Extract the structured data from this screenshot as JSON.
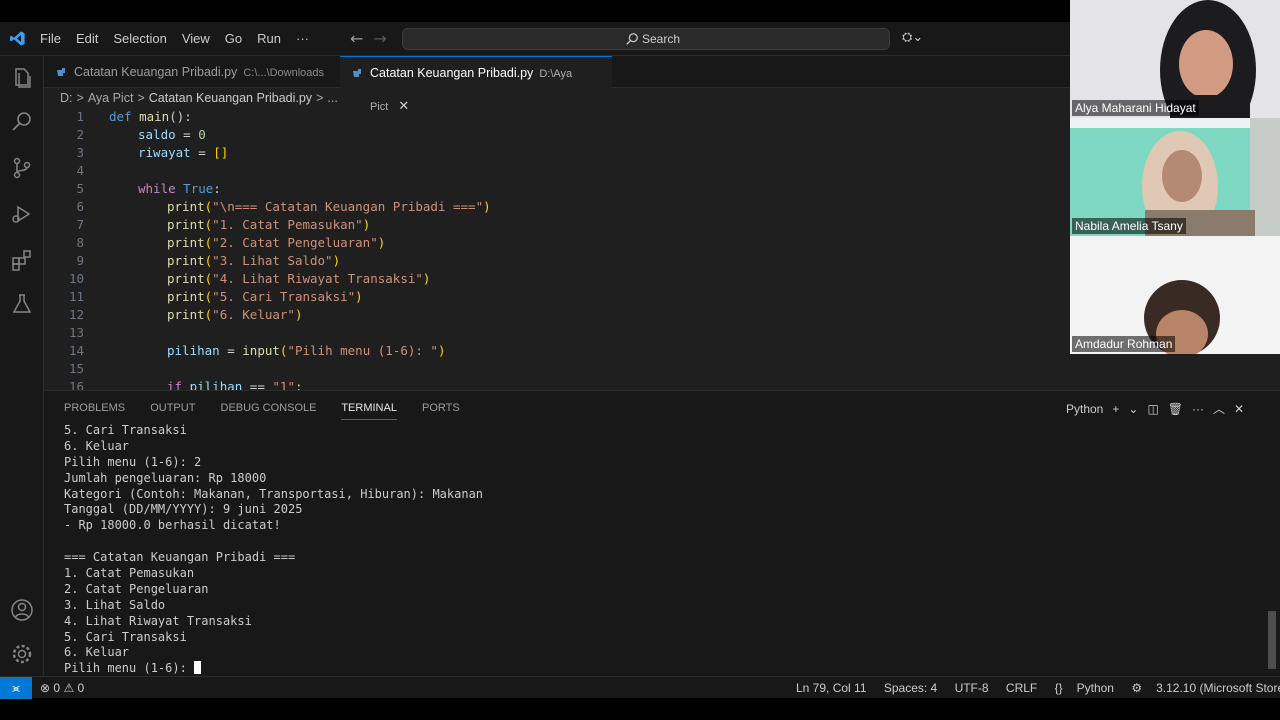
{
  "menu": [
    "File",
    "Edit",
    "Selection",
    "View",
    "Go",
    "Run",
    "···"
  ],
  "search_label": "Search",
  "tabs": [
    {
      "name": "Catatan Keuangan Pribadi.py",
      "path": "C:\\...\\Downloads",
      "active": false
    },
    {
      "name": "Catatan Keuangan Pribadi.py",
      "path": "D:\\Aya Pict",
      "active": true
    }
  ],
  "breadcrumb": [
    "D:",
    ">",
    "Aya Pict",
    ">",
    "Catatan Keuangan Pribadi.py",
    ">",
    "..."
  ],
  "line_numbers": [
    "1",
    "2",
    "3",
    "4",
    "5",
    "6",
    "7",
    "8",
    "9",
    "10",
    "11",
    "12",
    "13",
    "14",
    "15",
    "16"
  ],
  "code": {
    "l1_kw": "def",
    "l1_fn": "main",
    "l1_rest": "():",
    "l2_var": "saldo",
    "l2_op": " = ",
    "l2_num": "0",
    "l3_var": "riwayat",
    "l3_op": " = ",
    "l3_br": "[]",
    "l5_kw": "while",
    "l5_const": "True",
    "l5_rest": ":",
    "print_fn": "print",
    "p6": "\"\\n=== Catatan Keuangan Pribadi ===\"",
    "p7": "\"1. Catat Pemasukan\"",
    "p8": "\"2. Catat Pengeluaran\"",
    "p9": "\"3. Lihat Saldo\"",
    "p10": "\"4. Lihat Riwayat Transaksi\"",
    "p11": "\"5. Cari Transaksi\"",
    "p12": "\"6. Keluar\"",
    "l14_var": "pilihan",
    "l14_op": " = ",
    "l14_fn": "input",
    "l14_str": "\"Pilih menu (1-6): \"",
    "l16_kw": "if",
    "l16_var": "pilihan",
    "l16_op": " == ",
    "l16_str": "\"1\"",
    "l16_rest": ":"
  },
  "panel_tabs": [
    "PROBLEMS",
    "OUTPUT",
    "DEBUG CONSOLE",
    "TERMINAL",
    "PORTS"
  ],
  "panel_actions": {
    "shell": "Python",
    "add": "+",
    "chev": "⌄",
    "split": "◫",
    "trash": "🗑",
    "more": "···",
    "up": "︿",
    "close": "✕"
  },
  "terminal_lines": [
    "5. Cari Transaksi",
    "6. Keluar",
    "Pilih menu (1-6): 2",
    "Jumlah pengeluaran: Rp 18000",
    "Kategori (Contoh: Makanan, Transportasi, Hiburan): Makanan",
    "Tanggal (DD/MM/YYYY): 9 juni 2025",
    "- Rp 18000.0 berhasil dicatat!",
    "",
    "=== Catatan Keuangan Pribadi ===",
    "1. Catat Pemasukan",
    "2. Catat Pengeluaran",
    "3. Lihat Saldo",
    "4. Lihat Riwayat Transaksi",
    "5. Cari Transaksi",
    "6. Keluar"
  ],
  "terminal_prompt": "Pilih menu (1-6): ",
  "status": {
    "errors": "0",
    "warnings": "0",
    "position": "Ln 79, Col 11",
    "spaces": "Spaces: 4",
    "encoding": "UTF-8",
    "eol": "CRLF",
    "language": "Python",
    "interpreter": "3.12.10 (Microsoft Store)"
  },
  "participants": [
    "Alya Maharani Hidayat",
    "Nabila Amelia Tsany",
    "Amdadur Rohman"
  ],
  "colors": {
    "accent": "#0078d4",
    "editor_bg": "#1f1f1f",
    "panel_bg": "#181818"
  }
}
